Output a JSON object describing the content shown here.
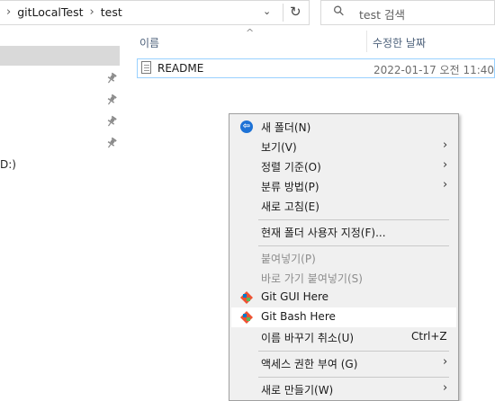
{
  "address": {
    "breadcrumb": [
      "gitLocalTest",
      "test"
    ],
    "dropdown_glyph": "⌄",
    "refresh_glyph": "↻"
  },
  "search": {
    "placeholder": "test 검색",
    "icon": "search-icon"
  },
  "nav": {
    "pin_icon": "📌",
    "drive_fragment": "D:)"
  },
  "columns": {
    "name": "이름",
    "date": "수정한 날짜",
    "sort_glyph": "^"
  },
  "files": [
    {
      "name": "README",
      "modified": "2022-01-17 오전 11:40",
      "icon": "document-icon"
    }
  ],
  "context_menu": {
    "items": [
      {
        "label": "새 폴더(N)",
        "icon": "globe-icon"
      },
      {
        "label": "보기(V)",
        "submenu": true
      },
      {
        "label": "정렬 기준(O)",
        "submenu": true
      },
      {
        "label": "분류 방법(P)",
        "submenu": true
      },
      {
        "label": "새로 고침(E)"
      },
      {
        "label": "현재 폴더 사용자 지정(F)..."
      },
      {
        "label": "붙여넣기(P)",
        "disabled": true
      },
      {
        "label": "바로 가기 붙여넣기(S)",
        "disabled": true
      },
      {
        "label": "Git GUI Here",
        "icon": "git-icon"
      },
      {
        "label": "Git Bash Here",
        "icon": "git-icon",
        "hover": true
      },
      {
        "label": "이름 바꾸기 취소(U)",
        "shortcut": "Ctrl+Z"
      },
      {
        "label": "액세스 권한 부여 (G)",
        "submenu": true
      },
      {
        "label": "새로 만들기(W)",
        "submenu": true
      }
    ],
    "arrow_glyph": "〉"
  },
  "colors": {
    "selection_border": "#99d1ff",
    "nav_selected": "#d9d9d9",
    "menu_bg": "#f0f0f0",
    "menu_hover": "#ffffff",
    "globe": "#1d72d6",
    "git_orange": "#f05133",
    "git_blue": "#0079c8",
    "git_green": "#5ab65a"
  }
}
